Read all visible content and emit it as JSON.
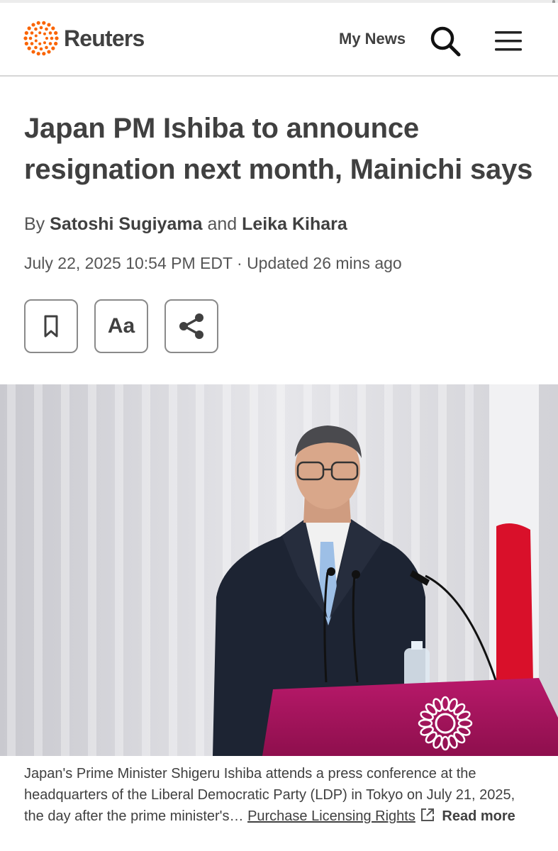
{
  "header": {
    "brand": "Reuters",
    "my_news_label": "My News",
    "search_icon": "search-icon",
    "menu_icon": "hamburger-menu-icon"
  },
  "article": {
    "headline_line1": "Japan PM Ishiba to announce",
    "headline_line2": "resignation next month, Mainichi says",
    "byline_prefix": "By",
    "author1": "Satoshi Sugiyama",
    "byline_and": "and",
    "author2": "Leika Kihara",
    "dateline": "July 22, 2025 10:54 PM EDT · Updated 26 mins ago",
    "tools": {
      "bookmark_icon": "bookmark-icon",
      "text_size_label": "Aa",
      "share_icon": "share-icon"
    },
    "image": {
      "caption": "Japan's Prime Minister Shigeru Ishiba attends a press conference at the headquarters of the Liberal Democratic Party (LDP) in Tokyo on July 21, 2025, the day after the prime minister's…",
      "licensing_link": "Purchase Licensing Rights",
      "read_more": "Read more"
    }
  },
  "colors": {
    "brand_orange": "#fa6400",
    "text_dark": "#404040",
    "podium_magenta": "#a0145a",
    "flag_red": "#d9102a"
  }
}
